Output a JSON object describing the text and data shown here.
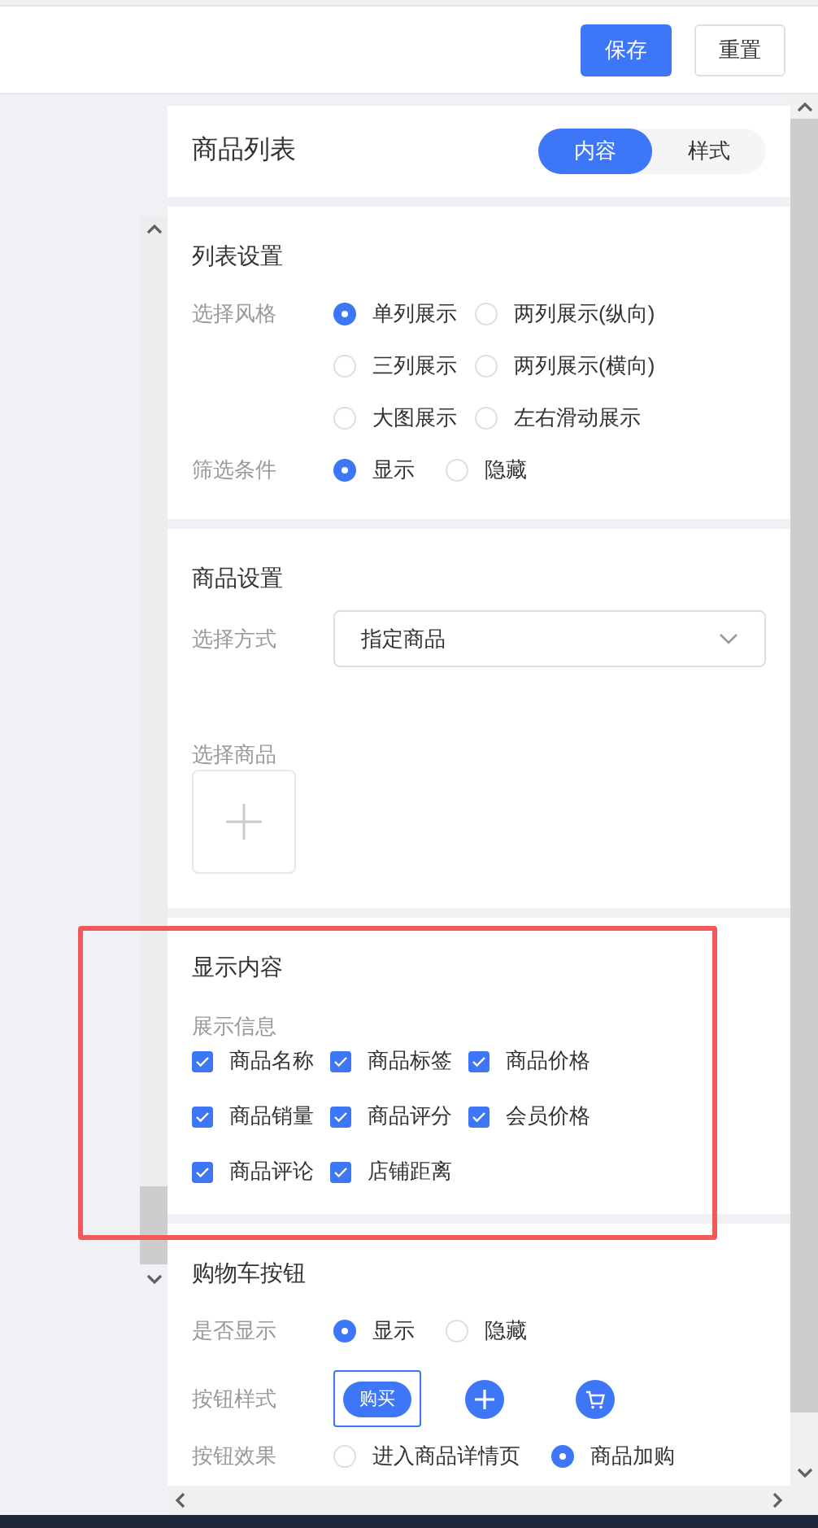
{
  "header": {
    "buttons": [
      {
        "label": "保存",
        "kind": "primary"
      },
      {
        "label": "重置",
        "kind": "default"
      }
    ]
  },
  "component": {
    "title": "商品列表",
    "tabs": [
      {
        "label": "内容",
        "selected": true
      },
      {
        "label": "样式",
        "selected": false
      }
    ]
  },
  "sections": [
    {
      "title": "列表设置",
      "fields": [
        {
          "kind": "radio-grid",
          "label": "选择风格",
          "options": [
            {
              "label": "单列展示",
              "selected": true
            },
            {
              "label": "两列展示(纵向)",
              "selected": false
            },
            {
              "label": "三列展示",
              "selected": false
            },
            {
              "label": "两列展示(横向)",
              "selected": false
            },
            {
              "label": "大图展示",
              "selected": false
            },
            {
              "label": "左右滑动展示",
              "selected": false
            }
          ]
        },
        {
          "kind": "radio",
          "label": "筛选条件",
          "options": [
            {
              "label": "显示",
              "selected": true
            },
            {
              "label": "隐藏",
              "selected": false
            }
          ]
        }
      ]
    },
    {
      "title": "商品设置",
      "fields": [
        {
          "kind": "select",
          "label": "选择方式",
          "value": "指定商品"
        },
        {
          "kind": "picker",
          "label": "选择商品"
        }
      ]
    },
    {
      "title": "显示内容",
      "highlighted": true,
      "fields": [
        {
          "kind": "checkboxes",
          "label": "展示信息",
          "options": [
            {
              "label": "商品名称",
              "checked": true
            },
            {
              "label": "商品标签",
              "checked": true
            },
            {
              "label": "商品价格",
              "checked": true
            },
            {
              "label": "商品销量",
              "checked": true
            },
            {
              "label": "商品评分",
              "checked": true
            },
            {
              "label": "会员价格",
              "checked": true
            },
            {
              "label": "商品评论",
              "checked": true
            },
            {
              "label": "店铺距离",
              "checked": true
            }
          ]
        }
      ]
    },
    {
      "title": "购物车按钮",
      "fields": [
        {
          "kind": "radio",
          "label": "是否显示",
          "options": [
            {
              "label": "显示",
              "selected": true
            },
            {
              "label": "隐藏",
              "selected": false
            }
          ]
        },
        {
          "kind": "styles",
          "label": "按钮样式",
          "options": [
            {
              "kind": "text",
              "label": "购买",
              "selected": true
            },
            {
              "kind": "plus",
              "selected": false
            },
            {
              "kind": "cart",
              "selected": false
            }
          ]
        },
        {
          "kind": "radio",
          "label": "按钮效果",
          "options": [
            {
              "label": "进入商品详情页",
              "selected": false
            },
            {
              "label": "商品加购",
              "selected": true
            }
          ]
        }
      ]
    }
  ]
}
